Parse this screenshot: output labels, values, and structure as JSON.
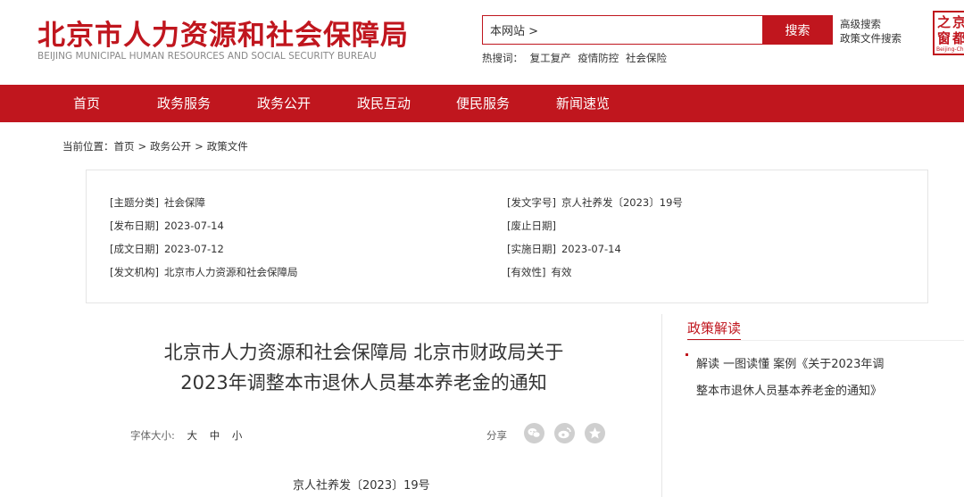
{
  "header": {
    "title": "北京市人力资源和社会保障局",
    "subtitle": "BEIJING MUNICIPAL HUMAN RESOURCES AND SOCIAL SECURITY BUREAU",
    "search": {
      "scope_value": "本网站 >",
      "button_label": "搜索"
    },
    "hot_label": "热搜词：",
    "hot_words": [
      "复工复产",
      "疫情防控",
      "社会保险"
    ],
    "advanced_search": "高级搜索",
    "policy_search": "政策文件搜索",
    "seal": {
      "row1": "之京",
      "row2": "窗都",
      "en": "Beijing-Ch"
    }
  },
  "nav": {
    "items": [
      "首页",
      "政务服务",
      "政务公开",
      "政民互动",
      "便民服务",
      "新闻速览"
    ]
  },
  "breadcrumb": {
    "prefix": "当前位置：",
    "items": [
      "首页",
      "政务公开",
      "政策文件"
    ],
    "separator": ">"
  },
  "meta": {
    "topic_key": "[主题分类]",
    "topic_val": "社会保障",
    "doc_no_key": "[发文字号]",
    "doc_no_val": "京人社养发〔2023〕19号",
    "publish_key": "[发布日期]",
    "publish_val": "2023-07-14",
    "abolish_key": "[废止日期]",
    "abolish_val": "",
    "written_key": "[成文日期]",
    "written_val": "2023-07-12",
    "effective_key": "[实施日期]",
    "effective_val": "2023-07-14",
    "issuer_key": "[发文机构]",
    "issuer_val": "北京市人力资源和社会保障局",
    "validity_key": "[有效性]",
    "validity_val": "有效"
  },
  "document": {
    "title_line1": "北京市人力资源和社会保障局 北京市财政局关于",
    "title_line2": "2023年调整本市退休人员基本养老金的通知",
    "font_size_label": "字体大小:",
    "font_size_options": [
      "大",
      "中",
      "小"
    ],
    "share_label": "分享",
    "number": "京人社养发〔2023〕19号"
  },
  "sidebar": {
    "title": "政策解读",
    "link_line1": "解读 一图读懂 案例《关于2023年调",
    "link_line2": "整本市退休人员基本养老金的通知》"
  },
  "colors": {
    "brand_red": "#c0161e",
    "icon_gray": "#cfcfcf"
  }
}
